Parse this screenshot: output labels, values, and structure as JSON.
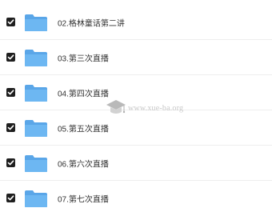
{
  "items": [
    {
      "name": "02.格林童话第二讲",
      "checked": true
    },
    {
      "name": "03.第三次直播",
      "checked": true
    },
    {
      "name": "04.第四次直播",
      "checked": true
    },
    {
      "name": "05.第五次直播",
      "checked": true
    },
    {
      "name": "06.第六次直播",
      "checked": true
    },
    {
      "name": "07.第七次直播",
      "checked": true
    }
  ],
  "watermark": {
    "text": "www.xue-ba.org"
  },
  "colors": {
    "folder_body": "#6db7f2",
    "folder_tab": "#5aa6e8",
    "checkbox": "#1f1f1f"
  },
  "icons": {
    "folder": "folder-icon",
    "checkbox": "checkbox-icon",
    "watermark": "graduation-cap-icon"
  }
}
